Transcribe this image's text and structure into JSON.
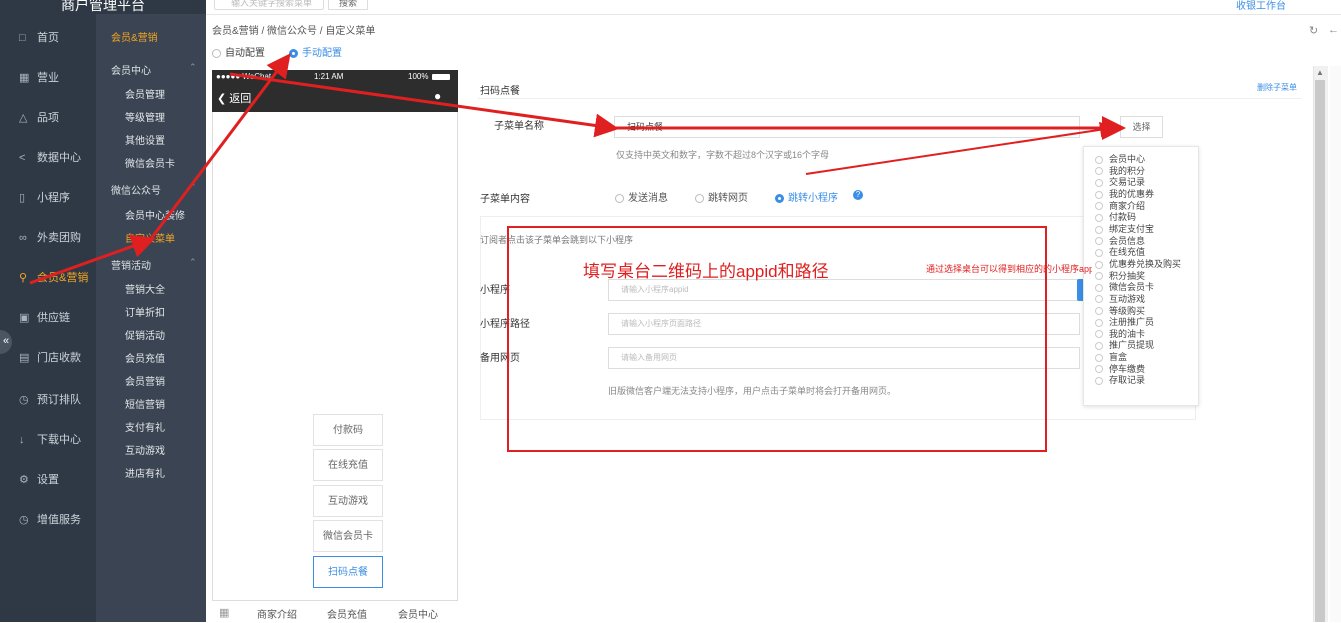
{
  "topbar": {
    "brand": "商户管理平台",
    "search_placeholder": "输入关键字搜索菜单",
    "search_button": "搜索",
    "top_link": "收银工作台"
  },
  "sidebar": {
    "items": [
      {
        "label": "首页",
        "icon": "home-icon"
      },
      {
        "label": "营业",
        "icon": "calendar-icon"
      },
      {
        "label": "品项",
        "icon": "bag-icon"
      },
      {
        "label": "数据中心",
        "icon": "share-icon"
      },
      {
        "label": "小程序",
        "icon": "phone-icon"
      },
      {
        "label": "外卖团购",
        "icon": "link-icon"
      },
      {
        "label": "会员&营销",
        "icon": "user-icon"
      },
      {
        "label": "供应链",
        "icon": "truck-icon"
      },
      {
        "label": "门店收款",
        "icon": "database-icon"
      },
      {
        "label": "预订排队",
        "icon": "clock-icon"
      },
      {
        "label": "下载中心",
        "icon": "download-icon"
      },
      {
        "label": "设置",
        "icon": "gear-icon"
      },
      {
        "label": "增值服务",
        "icon": "alarm-icon"
      }
    ],
    "active": "会员&营销"
  },
  "submenu": {
    "title": "会员&营销",
    "groups": [
      {
        "label": "会员中心",
        "items": [
          "会员管理",
          "等级管理",
          "其他设置",
          "微信会员卡"
        ]
      },
      {
        "label": "微信公众号",
        "items": [
          "会员中心装修",
          "自定义菜单"
        ]
      },
      {
        "label": "营销活动",
        "items": [
          "营销大全",
          "订单折扣",
          "促销活动",
          "会员充值",
          "会员营销",
          "短信营销",
          "支付有礼",
          "互动游戏",
          "进店有礼"
        ]
      }
    ]
  },
  "breadcrumb": "会员&营销 / 微信公众号 / 自定义菜单",
  "mode": {
    "auto": "自动配置",
    "manual": "手动配置",
    "selected": "手动配置"
  },
  "phone": {
    "carrier": "●●●●● WeChat",
    "time": "1:21 AM",
    "battery": "100%",
    "back": "返回",
    "submenu_items": [
      "付款码",
      "在线充值",
      "互动游戏",
      "微信会员卡",
      "扫码点餐"
    ],
    "selected_submenu": "扫码点餐",
    "bottom_menu": [
      "商家介绍",
      "会员充值",
      "会员中心"
    ]
  },
  "editor": {
    "title": "扫码点餐",
    "delete": "删除子菜单",
    "name_label": "子菜单名称",
    "name_value": "扫码点餐",
    "select_button": "选择",
    "name_hint": "仅支持中英文和数字，字数不超过8个汉字或16个字母",
    "content_label": "子菜单内容",
    "content_options": [
      "发送消息",
      "跳转网页",
      "跳转小程序"
    ],
    "content_selected": "跳转小程序",
    "panel_desc": "订阅者点击该子菜单会跳到以下小程序",
    "miniprogram_label": "小程序",
    "miniprogram_placeholder": "请输入小程序appid",
    "path_label": "小程序路径",
    "path_placeholder": "请输入小程序页面路径",
    "backup_label": "备用网页",
    "backup_placeholder": "请输入备用网页",
    "legacy_hint": "旧版微信客户端无法支持小程序，用户点击子菜单时将会打开备用网页。"
  },
  "dropdown": [
    "会员中心",
    "我的积分",
    "交易记录",
    "我的优惠券",
    "商家介绍",
    "付款码",
    "绑定支付宝",
    "会员信息",
    "在线充值",
    "优惠券兑换及购买",
    "积分抽奖",
    "微信会员卡",
    "互动游戏",
    "等级购买",
    "注册推广员",
    "我的油卡",
    "推广员提现",
    "盲盒",
    "停车缴费",
    "存取记录"
  ],
  "annotations": {
    "big": "填写桌台二维码上的appid和路径",
    "small": "通过选择桌台可以得到相应的的小程序appid和路径"
  },
  "colors": {
    "accent": "#3a8ee6",
    "annotation": "#e02020",
    "sidebar": "#2f3946",
    "active": "#f5a623"
  }
}
